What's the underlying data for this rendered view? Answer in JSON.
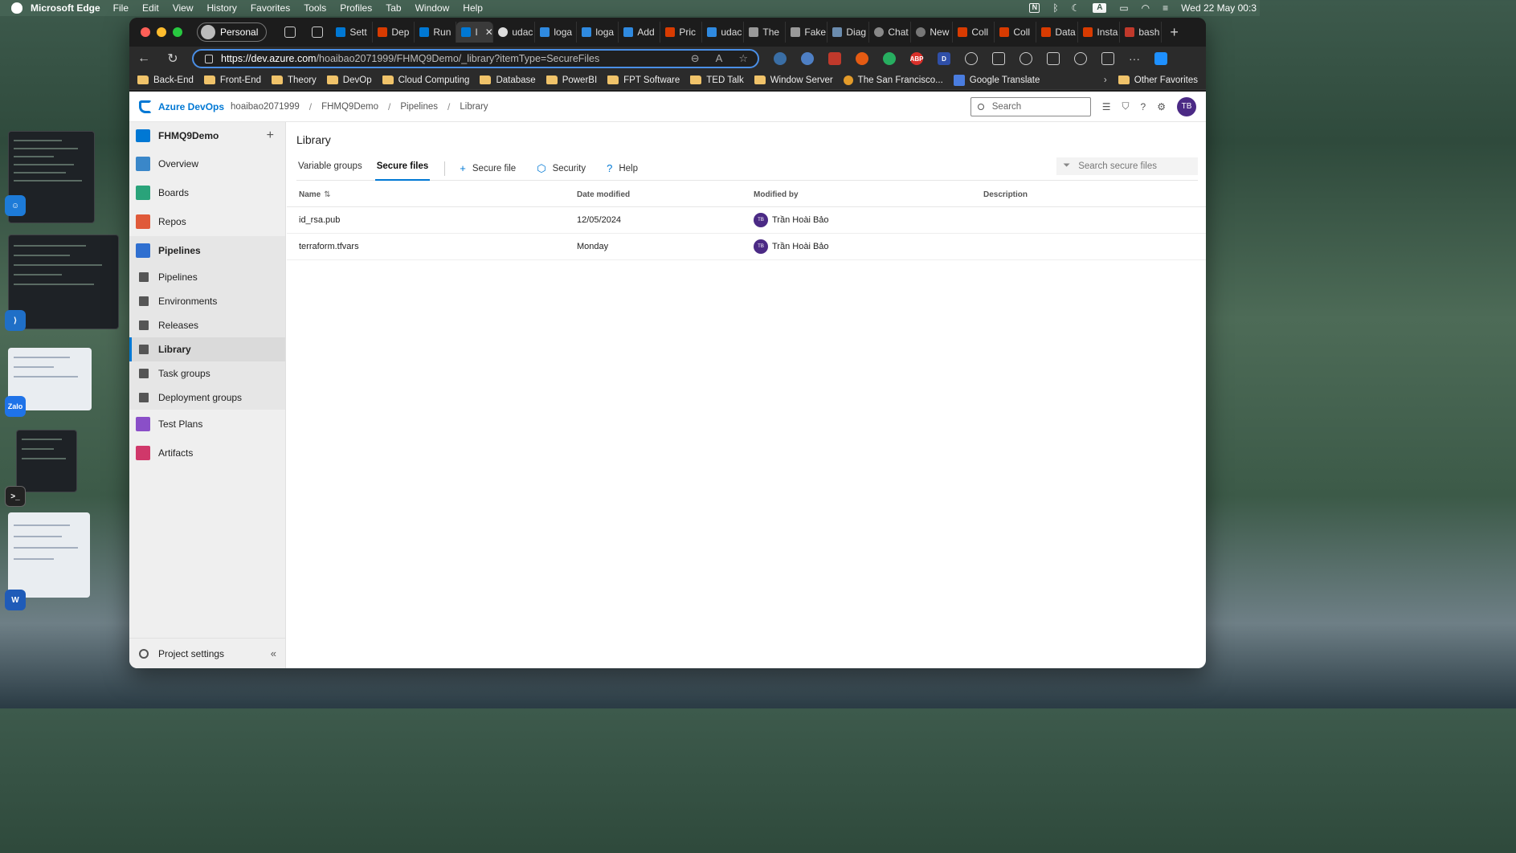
{
  "menubar": {
    "app": "Microsoft Edge",
    "items": [
      "File",
      "Edit",
      "View",
      "History",
      "Favorites",
      "Tools",
      "Profiles",
      "Tab",
      "Window",
      "Help"
    ],
    "datetime": "Wed 22 May  00:3"
  },
  "dock": {
    "zalo_label": "Zalo"
  },
  "browser": {
    "profile": "Personal",
    "tabs": [
      "Sett",
      "Dep",
      "Run",
      "I",
      "udac",
      "loga",
      "loga",
      "Add",
      "Pric",
      "udac",
      "The",
      "Fake",
      "Diag",
      "Chat",
      "New",
      "Coll",
      "Coll",
      "Data",
      "Insta",
      "bash"
    ],
    "url_domain": "https://dev.azure.com",
    "url_path": "/hoaibao2071999/FHMQ9Demo/_library?itemType=SecureFiles",
    "extensions": [
      "ABP",
      "D"
    ],
    "bookmarks": [
      "Back-End",
      "Front-End",
      "Theory",
      "DevOp",
      "Cloud Computing",
      "Database",
      "PowerBI",
      "FPT Software",
      "TED Talk",
      "Window Server",
      "The San Francisco...",
      "Google Translate"
    ],
    "other_favorites": "Other Favorites"
  },
  "ado": {
    "brand": "Azure DevOps",
    "breadcrumb": [
      "hoaibao2071999",
      "FHMQ9Demo",
      "Pipelines",
      "Library"
    ],
    "search_placeholder": "Search",
    "user_initials": "TB",
    "project": "FHMQ9Demo",
    "nav": {
      "overview": "Overview",
      "boards": "Boards",
      "repos": "Repos",
      "pipelines": "Pipelines",
      "sub_pipelines": "Pipelines",
      "environments": "Environments",
      "releases": "Releases",
      "library": "Library",
      "task_groups": "Task groups",
      "deployment_groups": "Deployment groups",
      "test_plans": "Test Plans",
      "artifacts": "Artifacts"
    },
    "project_settings": "Project settings",
    "page_title": "Library",
    "pivots": {
      "variable_groups": "Variable groups",
      "secure_files": "Secure files"
    },
    "commands": {
      "secure_file": "Secure file",
      "security": "Security",
      "help": "Help"
    },
    "filter_placeholder": "Search secure files",
    "columns": {
      "name": "Name",
      "date_modified": "Date modified",
      "modified_by": "Modified by",
      "description": "Description"
    },
    "rows": [
      {
        "name": "id_rsa.pub",
        "date": "12/05/2024",
        "initials": "TB",
        "by": "Trần Hoài Bảo",
        "description": ""
      },
      {
        "name": "terraform.tfvars",
        "date": "Monday",
        "initials": "TB",
        "by": "Trần Hoài Bảo",
        "description": ""
      }
    ]
  }
}
